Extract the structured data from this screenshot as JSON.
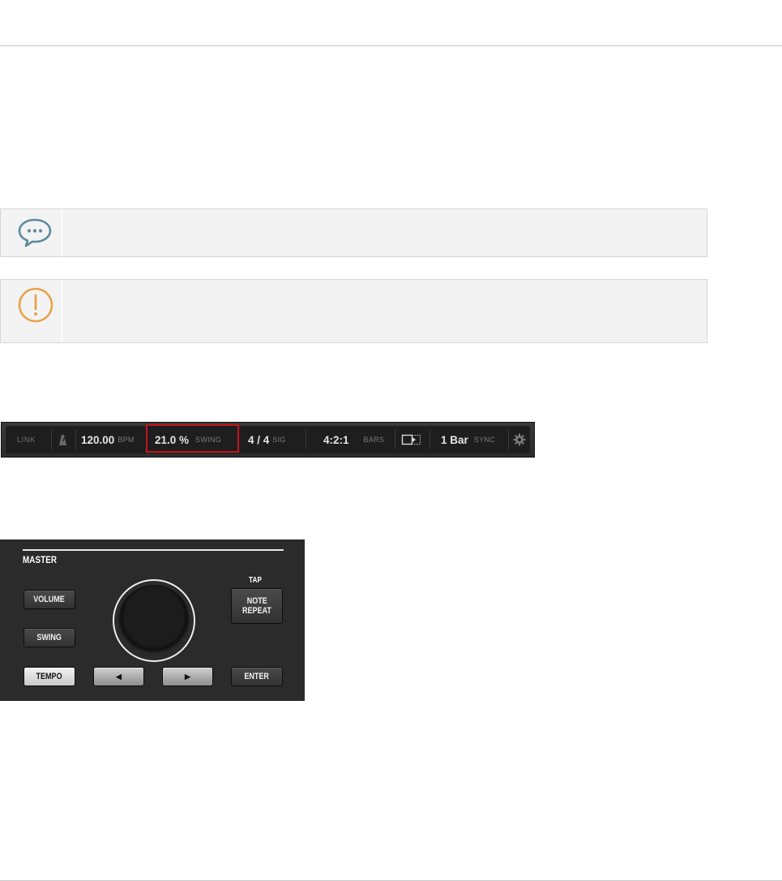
{
  "tip_icon": "speech-bubble-icon",
  "warning_icon": "exclamation-circle-icon",
  "colors": {
    "tip_icon": "#5d8aa0",
    "warning_icon": "#e8a24a",
    "highlight": "#c4141b"
  },
  "header": {
    "link": "LINK",
    "tempo_value": "120.00",
    "tempo_unit": "BPM",
    "swing_value": "21.0 %",
    "swing_unit": "SWING",
    "signature_value": "4 / 4",
    "signature_unit": "SIG",
    "position_value": "4:2:1",
    "position_unit": "BARS",
    "sync_value": "1 Bar",
    "sync_unit": "SYNC"
  },
  "controller": {
    "section_label": "MASTER",
    "tap_label": "TAP",
    "volume": "VOLUME",
    "swing": "SWING",
    "tempo": "TEMPO",
    "note_repeat_line1": "NOTE",
    "note_repeat_line2": "REPEAT",
    "enter": "ENTER",
    "left_arrow": "◀",
    "right_arrow": "▶"
  }
}
